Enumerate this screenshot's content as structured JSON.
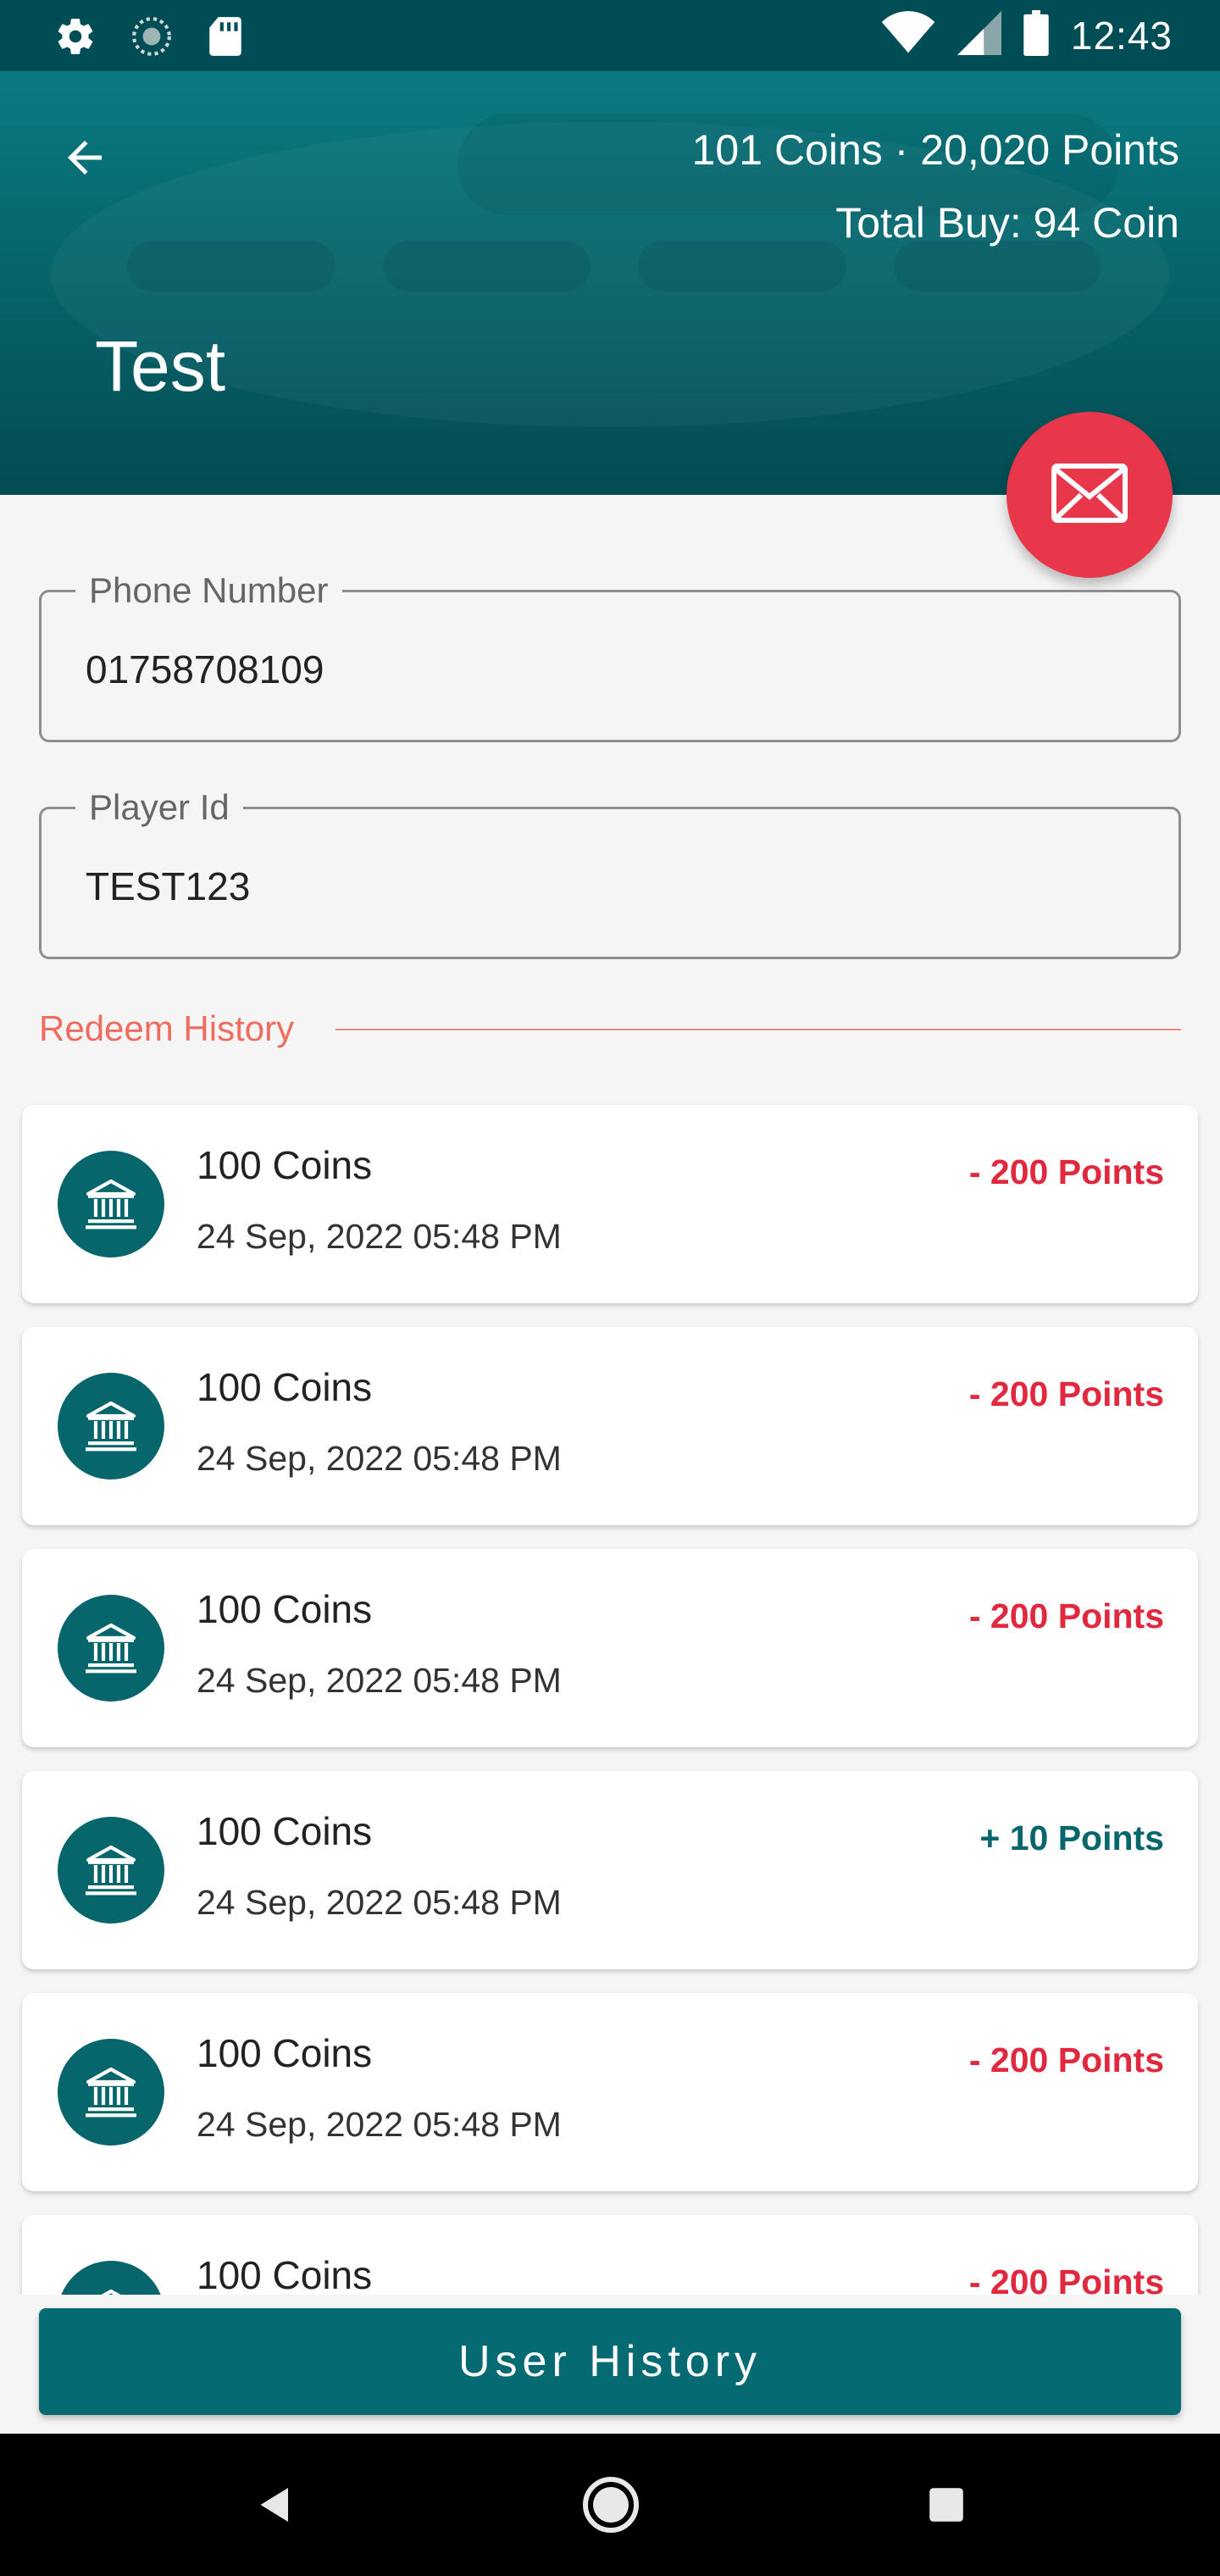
{
  "status_bar": {
    "time": "12:43",
    "left_icons": [
      "settings-icon",
      "sync-icon",
      "sd-card-icon"
    ],
    "right_icons": [
      "wifi-icon",
      "cellular-signal-icon",
      "battery-icon"
    ]
  },
  "header": {
    "balance": "101 Coins · 20,020 Points",
    "total_buy": "Total Buy: 94 Coin",
    "title": "Test",
    "back_icon": "arrow-back-icon"
  },
  "fab": {
    "icon": "mail-icon",
    "color": "#e8374a"
  },
  "form": {
    "phone": {
      "label": "Phone Number",
      "value": "01758708109"
    },
    "player": {
      "label": "Player Id",
      "value": "TEST123"
    }
  },
  "section": {
    "title": "Redeem History"
  },
  "history": [
    {
      "coins": "100 Coins",
      "date": "24 Sep, 2022 05:48 PM",
      "points": "- 200 Points",
      "type": "debit"
    },
    {
      "coins": "100 Coins",
      "date": "24 Sep, 2022 05:48 PM",
      "points": "- 200 Points",
      "type": "debit"
    },
    {
      "coins": "100 Coins",
      "date": "24 Sep, 2022 05:48 PM",
      "points": "- 200 Points",
      "type": "debit"
    },
    {
      "coins": "100 Coins",
      "date": "24 Sep, 2022 05:48 PM",
      "points": "+ 10 Points",
      "type": "credit"
    },
    {
      "coins": "100 Coins",
      "date": "24 Sep, 2022 05:48 PM",
      "points": "- 200 Points",
      "type": "debit"
    },
    {
      "coins": "100 Coins",
      "date": "",
      "points": "- 200 Points",
      "type": "debit"
    }
  ],
  "colors": {
    "debit": "#e0283f",
    "credit": "#07656c",
    "primary": "#056a72"
  },
  "bottom_button": {
    "label": "User History"
  },
  "nav_bar": {
    "icons": [
      "nav-back-icon",
      "nav-home-icon",
      "nav-recent-icon"
    ]
  }
}
